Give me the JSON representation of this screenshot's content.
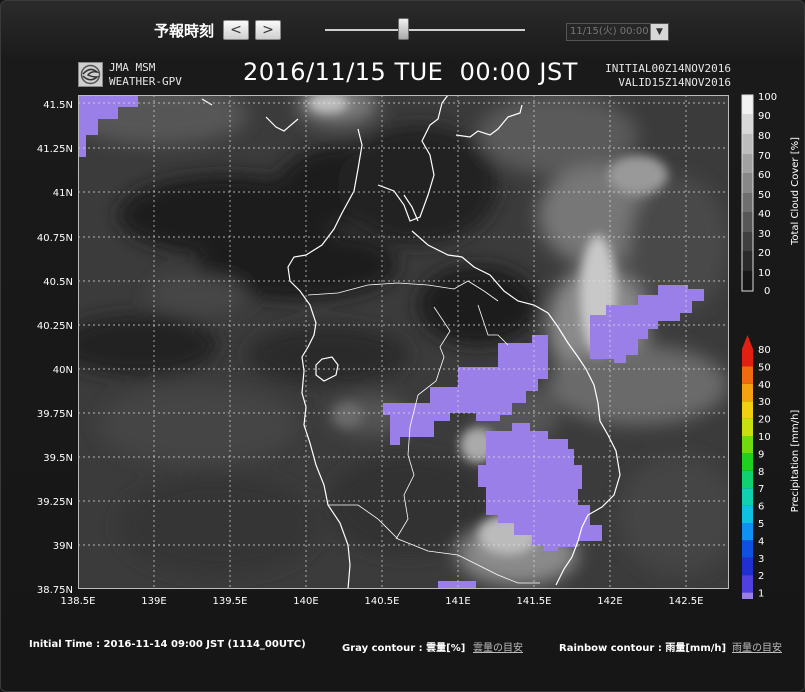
{
  "toolbar": {
    "label": "予報時刻",
    "prev_label": "<",
    "next_label": ">",
    "slider_position": 0.39,
    "select_value": "11/15(火) 00:00"
  },
  "header": {
    "brand_line1": "JMA MSM",
    "brand_line2": "WEATHER-GPV",
    "title": "2016/11/15 TUE  00:00 JST",
    "initial": "INITIAL00Z14NOV2016",
    "valid": "VALID15Z14NOV2016"
  },
  "map": {
    "lat_labels": [
      "41.5N",
      "41.25N",
      "41N",
      "40.75N",
      "40.5N",
      "40.25N",
      "40N",
      "39.75N",
      "39.5N",
      "39.25N",
      "39N",
      "38.75N"
    ],
    "lon_labels": [
      "138.5E",
      "139E",
      "139.5E",
      "140E",
      "140.5E",
      "141E",
      "141.5E",
      "142E",
      "142.5E"
    ],
    "precip_color": "#9b7fe8"
  },
  "cloud_legend": {
    "title": "Total Cloud Cover [%]",
    "ticks": [
      "100",
      "90",
      "80",
      "70",
      "60",
      "50",
      "40",
      "30",
      "20",
      "10",
      "0"
    ]
  },
  "precip_legend": {
    "title": "Precipitation [mm/h]",
    "ticks": [
      "80",
      "50",
      "40",
      "30",
      "20",
      "10",
      "9",
      "8",
      "7",
      "6",
      "5",
      "4",
      "3",
      "2",
      "1"
    ],
    "colors": [
      "#e02010",
      "#f06a10",
      "#f4a210",
      "#f0d010",
      "#c8e010",
      "#70dc10",
      "#20d020",
      "#10d070",
      "#10d0b0",
      "#10c0e0",
      "#1090f0",
      "#1050e0",
      "#2030d0",
      "#5040e0",
      "#9b7fe8"
    ]
  },
  "footer": {
    "initial_time": "Initial Time : 2016-11-14 09:00 JST (1114_00UTC)",
    "gray_label": "Gray contour : 雲量[%]",
    "gray_link": "雲量の目安",
    "rainbow_label": "Rainbow contour : 雨量[mm/h]",
    "rainbow_link": "雨量の目安"
  }
}
